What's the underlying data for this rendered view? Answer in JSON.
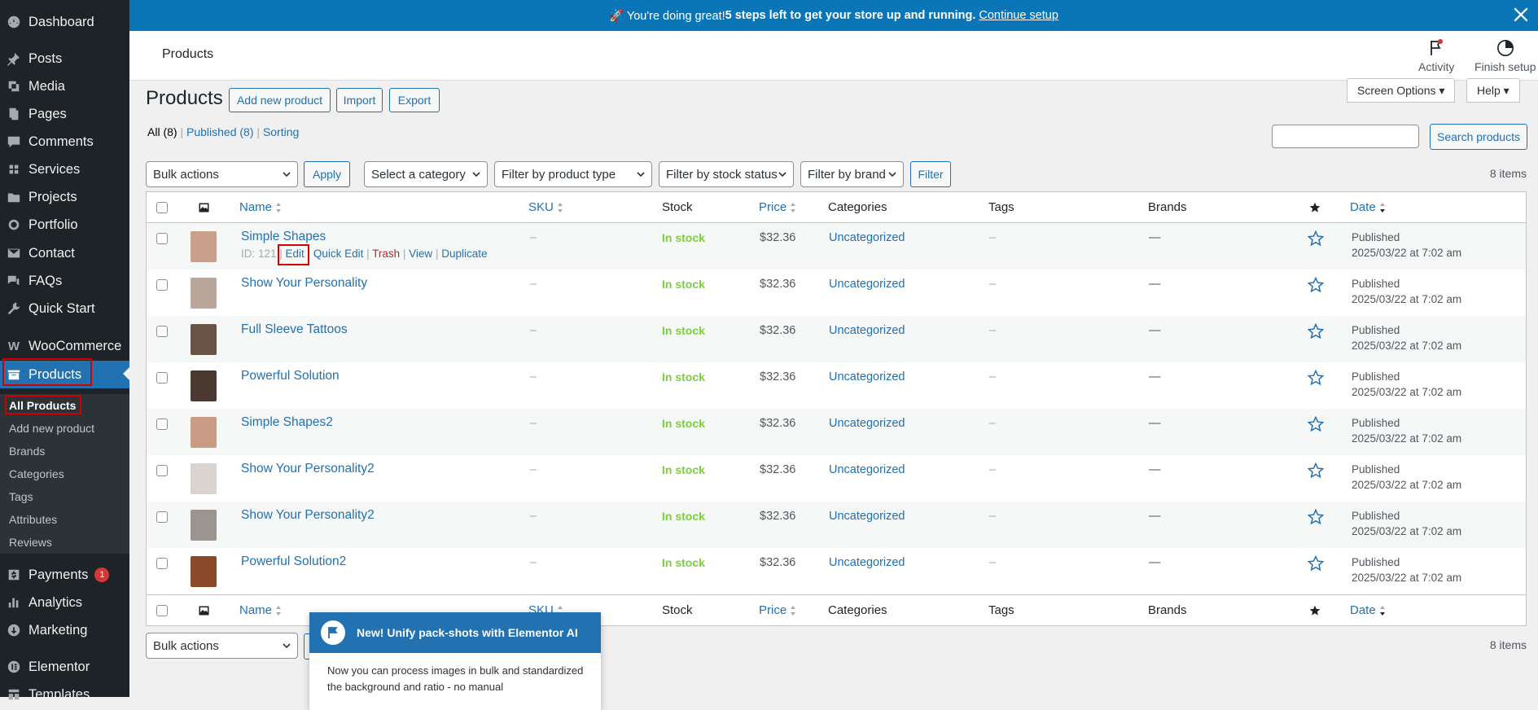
{
  "sidebar": {
    "items": [
      {
        "label": "Dashboard",
        "icon": "dashboard-icon"
      },
      {
        "label": "Posts",
        "icon": "pin-icon"
      },
      {
        "label": "Media",
        "icon": "media-icon"
      },
      {
        "label": "Pages",
        "icon": "pages-icon"
      },
      {
        "label": "Comments",
        "icon": "comments-icon"
      },
      {
        "label": "Services",
        "icon": "services-icon"
      },
      {
        "label": "Projects",
        "icon": "projects-icon"
      },
      {
        "label": "Portfolio",
        "icon": "portfolio-icon"
      },
      {
        "label": "Contact",
        "icon": "mail-icon"
      },
      {
        "label": "FAQs",
        "icon": "faq-icon"
      },
      {
        "label": "Quick Start",
        "icon": "wrench-icon"
      },
      {
        "label": "WooCommerce",
        "icon": "woocommerce-icon"
      },
      {
        "label": "Products",
        "icon": "products-icon"
      },
      {
        "label": "Payments",
        "icon": "payments-icon",
        "badge": "1"
      },
      {
        "label": "Analytics",
        "icon": "analytics-icon"
      },
      {
        "label": "Marketing",
        "icon": "marketing-icon"
      },
      {
        "label": "Elementor",
        "icon": "elementor-icon"
      },
      {
        "label": "Templates",
        "icon": "templates-icon"
      }
    ],
    "submenu": [
      "All Products",
      "Add new product",
      "Brands",
      "Categories",
      "Tags",
      "Attributes",
      "Reviews"
    ]
  },
  "banner": {
    "text": "🚀 You're doing great! ",
    "bold": "5 steps left to get your store up and running.",
    "link": "Continue setup"
  },
  "header": {
    "title": "Products",
    "activity": "Activity",
    "finish_setup": "Finish setup"
  },
  "page": {
    "heading": "Products",
    "add_new": "Add new product",
    "import": "Import",
    "export": "Export",
    "screen_options": "Screen Options ▾",
    "help": "Help ▾",
    "views": {
      "all": "All",
      "all_count": "(8)",
      "published": "Published",
      "published_count": "(8)",
      "sorting": "Sorting"
    },
    "search_value": "",
    "search_button": "Search products",
    "bulk_actions": "Bulk actions",
    "apply": "Apply",
    "select_category": "Select a category",
    "filter_type": "Filter by product type",
    "filter_stock": "Filter by stock status",
    "filter_brand": "Filter by brand",
    "filter": "Filter",
    "items_count": "8 items"
  },
  "columns": {
    "name": "Name",
    "sku": "SKU",
    "stock": "Stock",
    "price": "Price",
    "categories": "Categories",
    "tags": "Tags",
    "brands": "Brands",
    "date": "Date"
  },
  "row_actions": {
    "id": "ID: 121",
    "edit": "Edit",
    "quick_edit": "Quick Edit",
    "trash": "Trash",
    "view": "View",
    "duplicate": "Duplicate"
  },
  "products": [
    {
      "name": "Simple Shapes",
      "sku": "–",
      "stock": "In stock",
      "price": "$32.36",
      "category": "Uncategorized",
      "tags": "–",
      "brands": "—",
      "status": "Published",
      "date": "2025/03/22 at 7:02 am",
      "thumb": "#c9a08a"
    },
    {
      "name": "Show Your Personality",
      "sku": "–",
      "stock": "In stock",
      "price": "$32.36",
      "category": "Uncategorized",
      "tags": "–",
      "brands": "—",
      "status": "Published",
      "date": "2025/03/22 at 7:02 am",
      "thumb": "#b8a79a"
    },
    {
      "name": "Full Sleeve Tattoos",
      "sku": "–",
      "stock": "In stock",
      "price": "$32.36",
      "category": "Uncategorized",
      "tags": "–",
      "brands": "—",
      "status": "Published",
      "date": "2025/03/22 at 7:02 am",
      "thumb": "#6a5446"
    },
    {
      "name": "Powerful Solution",
      "sku": "–",
      "stock": "In stock",
      "price": "$32.36",
      "category": "Uncategorized",
      "tags": "–",
      "brands": "—",
      "status": "Published",
      "date": "2025/03/22 at 7:02 am",
      "thumb": "#4a3a32"
    },
    {
      "name": "Simple Shapes2",
      "sku": "–",
      "stock": "In stock",
      "price": "$32.36",
      "category": "Uncategorized",
      "tags": "–",
      "brands": "—",
      "status": "Published",
      "date": "2025/03/22 at 7:02 am",
      "thumb": "#c89d84"
    },
    {
      "name": "Show Your Personality2",
      "sku": "–",
      "stock": "In stock",
      "price": "$32.36",
      "category": "Uncategorized",
      "tags": "–",
      "brands": "—",
      "status": "Published",
      "date": "2025/03/22 at 7:02 am",
      "thumb": "#d9d4cf"
    },
    {
      "name": "Show Your Personality2",
      "sku": "–",
      "stock": "In stock",
      "price": "$32.36",
      "category": "Uncategorized",
      "tags": "–",
      "brands": "—",
      "status": "Published",
      "date": "2025/03/22 at 7:02 am",
      "thumb": "#9c948e"
    },
    {
      "name": "Powerful Solution2",
      "sku": "–",
      "stock": "In stock",
      "price": "$32.36",
      "category": "Uncategorized",
      "tags": "–",
      "brands": "—",
      "status": "Published",
      "date": "2025/03/22 at 7:02 am",
      "thumb": "#8a4a2a"
    }
  ],
  "popup": {
    "title": "New! Unify pack-shots with Elementor AI",
    "body": "Now you can process images in bulk and standardized the background and ratio - no manual"
  },
  "colors": {
    "accent": "#2271b1",
    "banner": "#0b76b7",
    "sidebar": "#1d2327",
    "in_stock": "#7ad03a",
    "highlight": "#d00000"
  }
}
